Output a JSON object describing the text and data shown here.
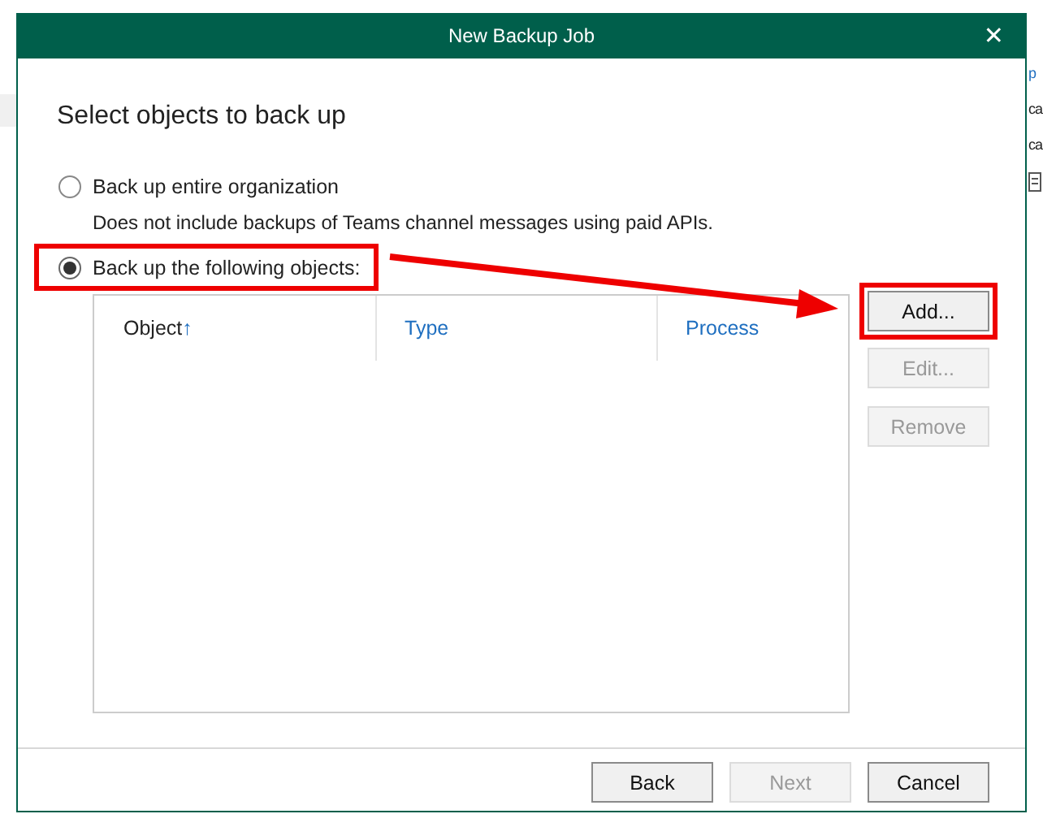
{
  "background": {
    "texts": [
      "p",
      "ca",
      "ca"
    ]
  },
  "window": {
    "title": "New Backup Job",
    "close": "✕"
  },
  "heading": "Select objects to back up",
  "options": [
    {
      "label": "Back up entire organization",
      "selected": false,
      "highlighted": false,
      "description": "Does not include backups of Teams channel messages using paid APIs."
    },
    {
      "label": "Back up the following objects:",
      "selected": true,
      "highlighted": true
    }
  ],
  "table": {
    "columns": [
      {
        "label": "Object",
        "sorted": true,
        "sort_indicator": "↑"
      },
      {
        "label": "Type",
        "sorted": false
      },
      {
        "label": "Process",
        "sorted": false
      }
    ]
  },
  "side_buttons": [
    {
      "label": "Add...",
      "disabled": false,
      "highlighted": true
    },
    {
      "label": "Edit...",
      "disabled": true,
      "highlighted": false
    },
    {
      "label": "Remove",
      "disabled": true,
      "highlighted": false
    }
  ],
  "footer_buttons": [
    {
      "label": "Back",
      "disabled": false
    },
    {
      "label": "Next",
      "disabled": true
    },
    {
      "label": "Cancel",
      "disabled": false
    }
  ],
  "annotations": {
    "arrow": true
  }
}
